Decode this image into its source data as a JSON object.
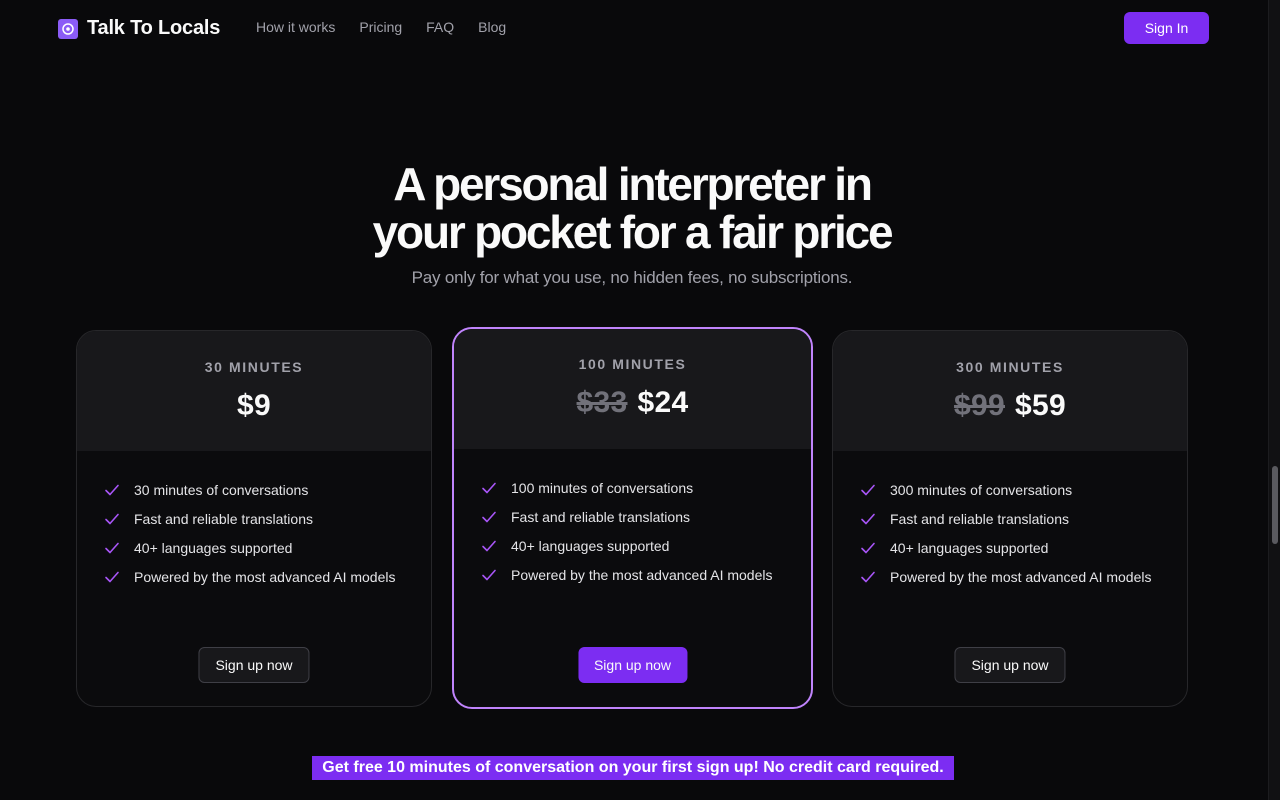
{
  "brand": {
    "name": "Talk To Locals",
    "logo_icon": "globe-icon",
    "accent_color": "#7c2df2"
  },
  "nav": {
    "items": [
      "How it works",
      "Pricing",
      "FAQ",
      "Blog"
    ],
    "signin_label": "Sign In"
  },
  "hero": {
    "title_line1": "A personal interpreter in",
    "title_line2": "your pocket for a fair price",
    "subtitle": "Pay only for what you use, no hidden fees, no subscriptions."
  },
  "plans": [
    {
      "name": "30 MINUTES",
      "old_price": "",
      "price": "$9",
      "features": [
        "30 minutes of conversations",
        "Fast and reliable translations",
        "40+ languages supported",
        "Powered by the most advanced AI models"
      ],
      "cta": "Sign up now",
      "featured": false
    },
    {
      "name": "100 MINUTES",
      "old_price": "$33",
      "price": "$24",
      "features": [
        "100 minutes of conversations",
        "Fast and reliable translations",
        "40+ languages supported",
        "Powered by the most advanced AI models"
      ],
      "cta": "Sign up now",
      "featured": true
    },
    {
      "name": "300 MINUTES",
      "old_price": "$99",
      "price": "$59",
      "features": [
        "300 minutes of conversations",
        "Fast and reliable translations",
        "40+ languages supported",
        "Powered by the most advanced AI models"
      ],
      "cta": "Sign up now",
      "featured": false
    }
  ],
  "promo": {
    "text": "Get free 10 minutes of conversation on your first sign up! No credit card required."
  },
  "colors": {
    "background": "#09090b",
    "card_top": "#18181b",
    "featured_border": "#c084fc",
    "check": "#a855f7"
  }
}
